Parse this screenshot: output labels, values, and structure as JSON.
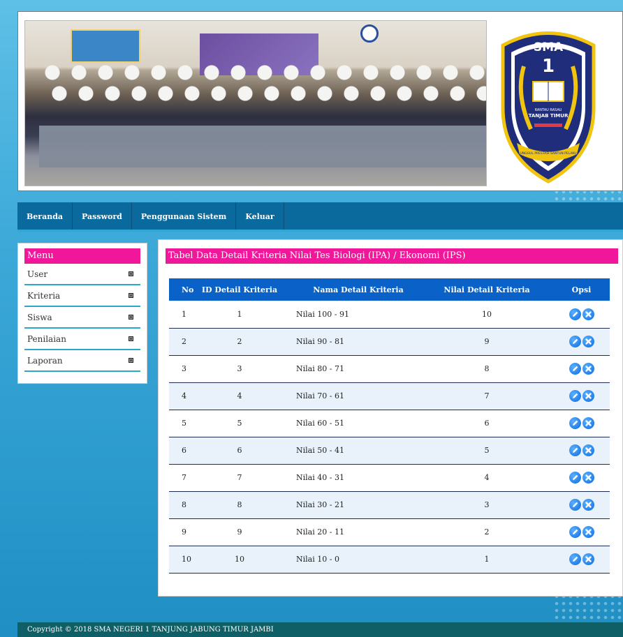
{
  "logo": {
    "top_text": "SMA",
    "number": "1",
    "line1": "RANTAU RASAU",
    "line2": "TANJAB TIMUR",
    "ribbon": "UNGGUL PRESTASI SANTUN PELAKU"
  },
  "nav": {
    "items": [
      "Beranda",
      "Password",
      "Penggunaan Sistem",
      "Keluar"
    ]
  },
  "sidebar": {
    "title": "Menu",
    "items": [
      "User",
      "Kriteria",
      "Siswa",
      "Penilaian",
      "Laporan"
    ]
  },
  "main": {
    "title": "Tabel Data Detail Kriteria Nilai Tes Biologi (IPA) / Ekonomi (IPS)",
    "columns": [
      "No",
      "ID Detail Kriteria",
      "Nama Detail Kriteria",
      "Nilai Detail Kriteria",
      "Opsi"
    ],
    "rows": [
      [
        "1",
        "1",
        "Nilai 100 - 91",
        "10"
      ],
      [
        "2",
        "2",
        "Nilai 90 - 81",
        "9"
      ],
      [
        "3",
        "3",
        "Nilai 80 - 71",
        "8"
      ],
      [
        "4",
        "4",
        "Nilai 70 - 61",
        "7"
      ],
      [
        "5",
        "5",
        "Nilai 60 - 51",
        "6"
      ],
      [
        "6",
        "6",
        "Nilai 50 - 41",
        "5"
      ],
      [
        "7",
        "7",
        "Nilai 40 - 31",
        "4"
      ],
      [
        "8",
        "8",
        "Nilai 30 - 21",
        "3"
      ],
      [
        "9",
        "9",
        "Nilai 20 - 11",
        "2"
      ],
      [
        "10",
        "10",
        "Nilai 10 - 0",
        "1"
      ]
    ],
    "icons": {
      "edit": "edit-pencil-icon",
      "delete": "delete-x-icon"
    }
  },
  "footer": {
    "text": "Copyright © 2018 SMA NEGERI 1 TANJUNG JABUNG TIMUR JAMBI"
  },
  "colors": {
    "nav_bg": "#0a6a9e",
    "accent_pink": "#f0179a",
    "table_header": "#0a62c8",
    "footer_bg": "#0f5f66"
  }
}
